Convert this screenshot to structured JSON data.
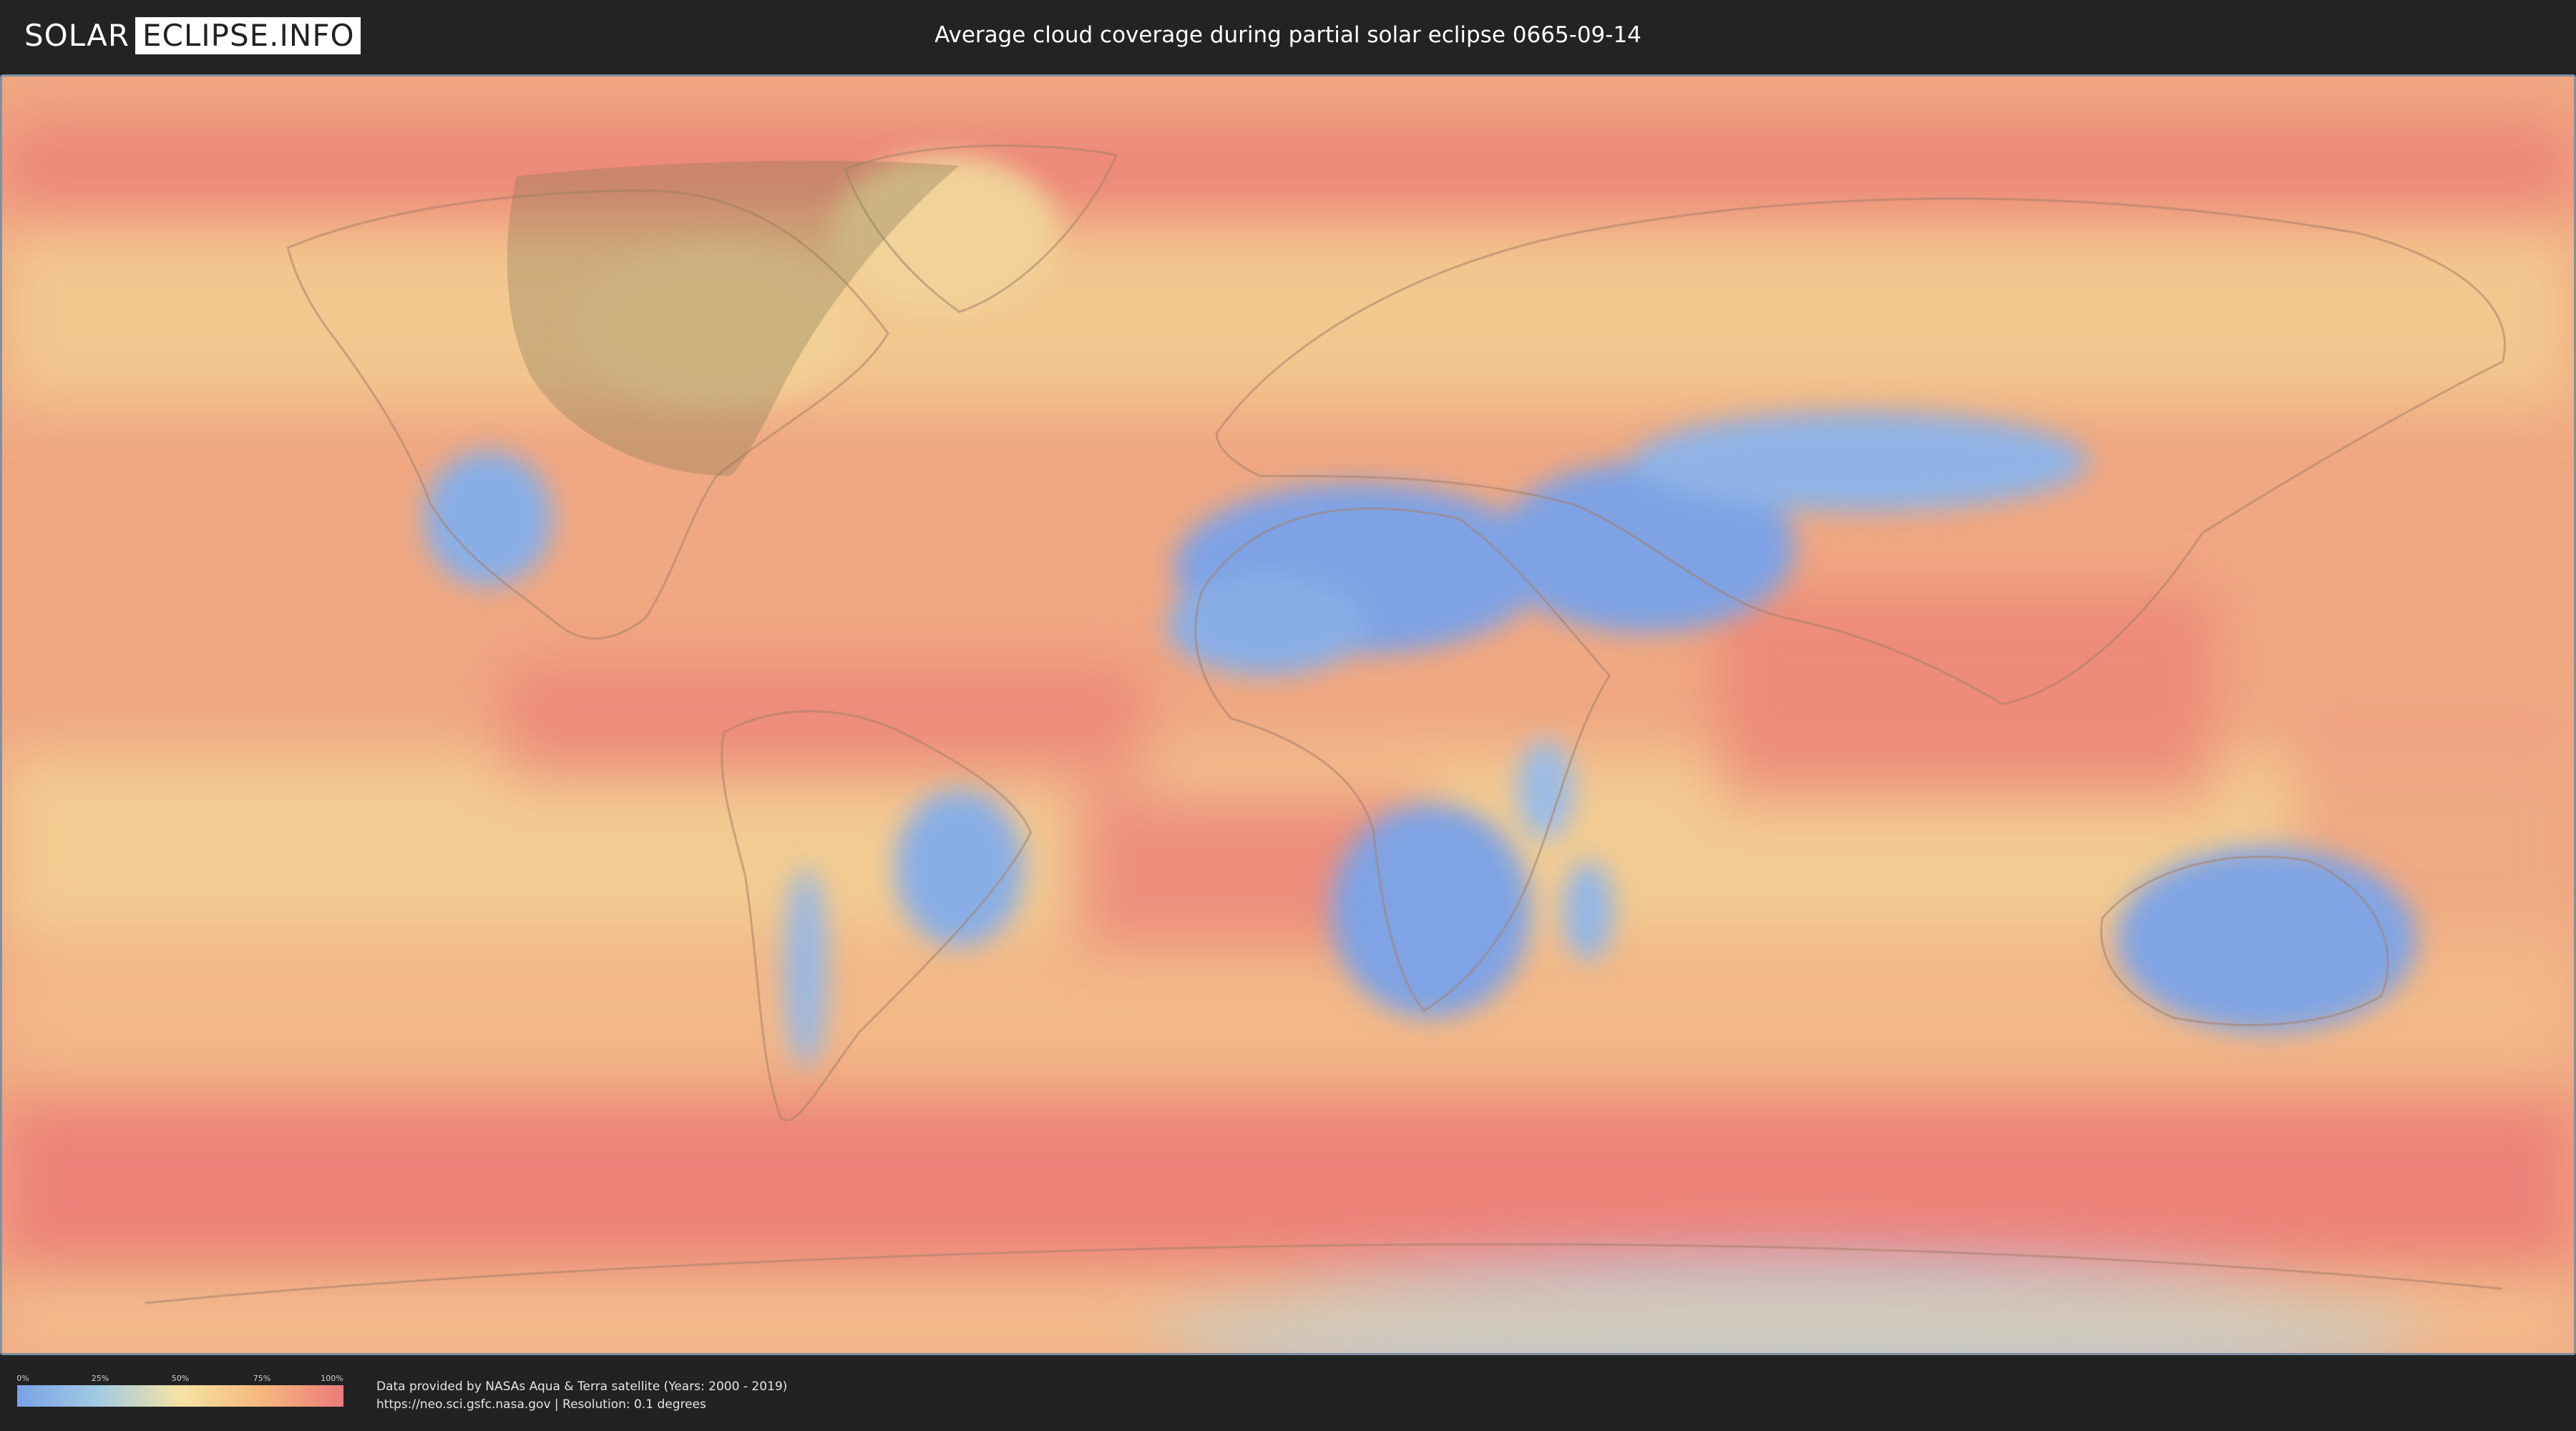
{
  "header": {
    "logo_part1": "SOLAR",
    "logo_part2": "ECLIPSE.INFO",
    "title": "Average cloud coverage during partial solar eclipse 0665-09-14"
  },
  "map": {
    "type": "cloud-coverage-world-map",
    "overlay": "partial-eclipse-visibility-shadow",
    "colors": {
      "low": "#7ba1e6",
      "mid_low": "#a3cbe3",
      "mid": "#f5e3a3",
      "mid_high": "#f5b77d",
      "high": "#ec7b7b",
      "ocean_base": "#f0a27e"
    }
  },
  "legend": {
    "ticks": [
      "0%",
      "25%",
      "50%",
      "75%",
      "100%"
    ]
  },
  "credits": {
    "line1": "Data provided by NASAs Aqua & Terra satellite (Years: 2000 - 2019)",
    "line2": "https://neo.sci.gsfc.nasa.gov | Resolution: 0.1 degrees"
  }
}
